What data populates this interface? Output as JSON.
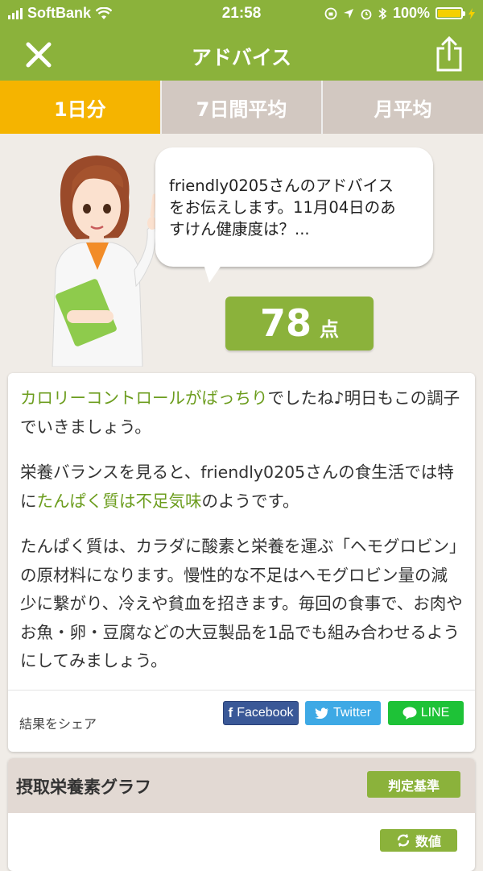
{
  "status_bar": {
    "carrier": "SoftBank",
    "time": "21:58",
    "battery_percent": "100%"
  },
  "nav": {
    "title": "アドバイス",
    "close_icon": "close-icon",
    "share_icon": "share-icon"
  },
  "tabs": [
    {
      "label": "1日分",
      "active": true
    },
    {
      "label": "7日間平均",
      "active": false
    },
    {
      "label": "月平均",
      "active": false
    }
  ],
  "bubble": {
    "line1": "friendly0205さんのアドバイス",
    "line2": "をお伝えします。11月04日のあ",
    "line3": "すけん健康度は？..."
  },
  "score": {
    "value": "78",
    "unit": "点"
  },
  "advice": {
    "p1": {
      "highlight": "カロリーコントロールがばっちり",
      "rest": "でしたね♪明日もこの調子でいきましょう。"
    },
    "p2": {
      "before": "栄養バランスを見ると、friendly0205さんの食生活では特に",
      "highlight": "たんぱく質は不足気味",
      "after": "のようです。"
    },
    "p3": "たんぱく質は、カラダに酸素と栄養を運ぶ「ヘモグロビン」の原材料になります。慢性的な不足はヘモグロビン量の減少に繋がり、冷えや貧血を招きます。毎回の食事で、お肉やお魚・卵・豆腐などの大豆製品を1品でも組み合わせるようにしてみましょう。"
  },
  "share": {
    "label": "結果をシェア",
    "facebook": "Facebook",
    "twitter": "Twitter",
    "line": "LINE"
  },
  "graph": {
    "title": "摂取栄養素グラフ",
    "judge_button": "判定基準",
    "value_button": "数値"
  },
  "colors": {
    "brand_green": "#8bb23b",
    "active_tab": "#f5b400",
    "highlight_text": "#6c9d1e",
    "facebook": "#3a5897",
    "twitter": "#3ea9e5",
    "line": "#1ec237"
  }
}
